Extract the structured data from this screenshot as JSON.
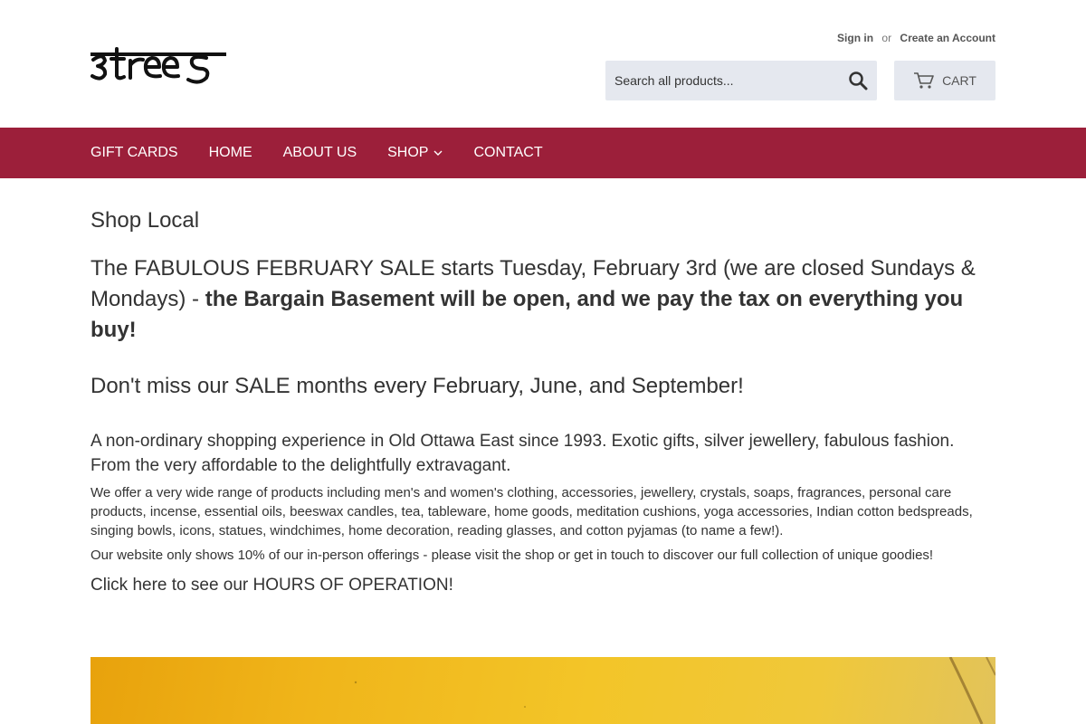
{
  "header": {
    "logo_text": "3 trees",
    "account": {
      "sign_in": "Sign in",
      "separator": "or",
      "create_account": "Create an Account"
    },
    "search": {
      "placeholder": "Search all products...",
      "icon": "search-icon"
    },
    "cart": {
      "label": "CART",
      "icon": "cart-icon"
    }
  },
  "nav": {
    "background": "#9c1f3a",
    "items": [
      {
        "label": "GIFT CARDS"
      },
      {
        "label": "HOME"
      },
      {
        "label": "ABOUT US"
      },
      {
        "label": "SHOP",
        "has_dropdown": true
      },
      {
        "label": "CONTACT"
      }
    ]
  },
  "main": {
    "title": "Shop Local",
    "sale_text_normal": "The FABULOUS FEBRUARY SALE starts Tuesday, February 3rd (we are closed Sundays & Mondays) - ",
    "sale_text_bold": "the Bargain Basement will be open, and we pay the tax on everything you buy!",
    "sale_months": "Don't miss our SALE months every February, June, and September!",
    "intro": "A non-ordinary shopping experience in Old Ottawa East since 1993. Exotic gifts, silver jewellery, fabulous fashion. From the very affordable to the delightfully extravagant.",
    "offer": "We offer a very wide range of products including men's and women's clothing, accessories, jewellery, crystals, soaps, fragrances, personal care products, incense, essential oils, beeswax candles, tea, tableware, home goods, meditation cushions, yoga accessories, Indian cotton bedspreads, singing bowls, icons, statues, windchimes, home decoration, reading glasses, and cotton pyjamas (to name a few!).",
    "website_note": "Our website only shows 10% of our in-person offerings - please visit the shop or get in touch to discover our full collection of unique goodies!",
    "hours_link": "Click here to see our HOURS OF OPERATION!"
  }
}
